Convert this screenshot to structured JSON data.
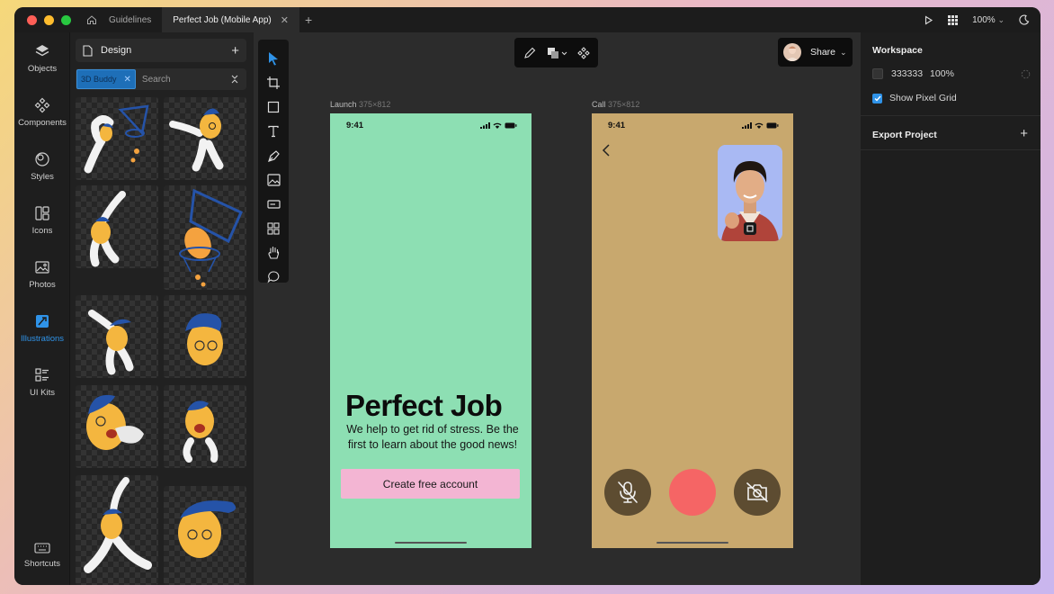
{
  "tabs": {
    "home_tab": "Guidelines",
    "active_tab": "Perfect Job (Mobile App)",
    "close_glyph": "✕",
    "add_glyph": "+"
  },
  "titlebar": {
    "zoom": "100%"
  },
  "leftnav": {
    "items": [
      {
        "label": "Objects",
        "icon": "layers-icon"
      },
      {
        "label": "Components",
        "icon": "components-icon"
      },
      {
        "label": "Styles",
        "icon": "styles-icon"
      },
      {
        "label": "Icons",
        "icon": "icons-icon"
      },
      {
        "label": "Photos",
        "icon": "photos-icon"
      },
      {
        "label": "Illustrations",
        "icon": "illustrations-icon",
        "active": true
      },
      {
        "label": "UI Kits",
        "icon": "ui-kits-icon"
      },
      {
        "label": "Shortcuts",
        "icon": "keyboard-icon"
      }
    ],
    "active_color": "#2f93e8"
  },
  "assets": {
    "title": "Design",
    "add_glyph": "+",
    "filter_chip": "3D Buddy",
    "filter_chip_close": "✕",
    "search_placeholder": "Search"
  },
  "canvas": {
    "share_label": "Share",
    "frames": [
      {
        "name": "Launch",
        "size": "375×812",
        "bg": "#8ddfb3",
        "time": "9:41",
        "headline": "Perfect Job",
        "subtitle": "We help to get rid of stress. Be the first to learn about the good news!",
        "cta": "Create free account",
        "cta_color": "#f3b5d3"
      },
      {
        "name": "Call",
        "size": "375×812",
        "bg": "#c8a86e",
        "time": "9:41",
        "end_call_color": "#f56565"
      }
    ]
  },
  "rightpanel": {
    "workspace_title": "Workspace",
    "bg_hex": "333333",
    "bg_opacity": "100%",
    "pixel_grid_label": "Show Pixel Grid",
    "pixel_grid_checked": true,
    "export_title": "Export Project",
    "export_add": "+"
  }
}
